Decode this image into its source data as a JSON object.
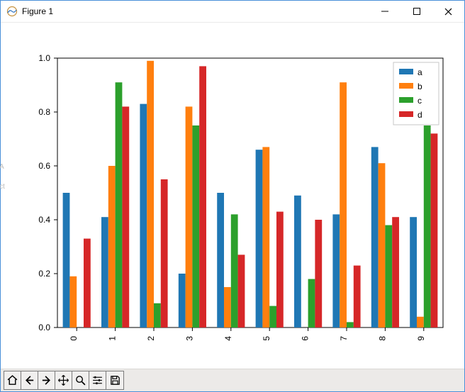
{
  "window": {
    "title": "Figure 1"
  },
  "titlebar_buttons": {
    "minimize": "minimize",
    "maximize": "maximize",
    "close": "close"
  },
  "left_trace": {
    "a": "A",
    "b": "ct"
  },
  "toolbar": {
    "home": "home",
    "back": "back",
    "forward": "forward",
    "pan": "pan",
    "zoom": "zoom",
    "configure": "configure",
    "save": "save"
  },
  "chart_data": {
    "type": "bar",
    "categories": [
      "0",
      "1",
      "2",
      "3",
      "4",
      "5",
      "6",
      "7",
      "8",
      "9"
    ],
    "series": [
      {
        "name": "a",
        "color": "#1f77b4",
        "values": [
          0.5,
          0.41,
          0.83,
          0.2,
          0.5,
          0.66,
          0.49,
          0.42,
          0.67,
          0.41
        ]
      },
      {
        "name": "b",
        "color": "#ff7f0e",
        "values": [
          0.19,
          0.6,
          0.99,
          0.82,
          0.15,
          0.67,
          0.0,
          0.91,
          0.61,
          0.04
        ]
      },
      {
        "name": "c",
        "color": "#2ca02c",
        "values": [
          0.0,
          0.91,
          0.09,
          0.75,
          0.42,
          0.08,
          0.18,
          0.02,
          0.38,
          0.75
        ]
      },
      {
        "name": "d",
        "color": "#d62728",
        "values": [
          0.33,
          0.82,
          0.55,
          0.97,
          0.27,
          0.43,
          0.4,
          0.23,
          0.41,
          0.72
        ]
      }
    ],
    "xlabel": "",
    "ylabel": "",
    "ylim": [
      0.0,
      1.0
    ],
    "yticks": [
      "0.0",
      "0.2",
      "0.4",
      "0.6",
      "0.8",
      "1.0"
    ],
    "legend_position": "upper-right"
  }
}
